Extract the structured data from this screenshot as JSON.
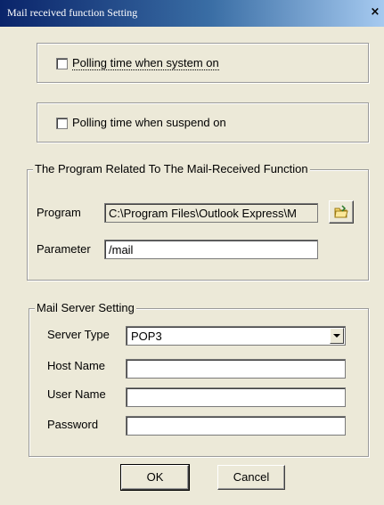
{
  "window": {
    "title": "Mail received function Setting",
    "close_glyph": "×"
  },
  "polling": {
    "system_on_label": "Polling time when system on",
    "system_on_checked": false,
    "suspend_on_label": "Polling time when suspend on",
    "suspend_on_checked": false
  },
  "program_group": {
    "legend": "The Program Related To The Mail-Received Function",
    "program_label": "Program",
    "program_value": "C:\\Program Files\\Outlook Express\\M",
    "browse_icon": "folder-browse-icon",
    "parameter_label": "Parameter",
    "parameter_value": "/mail"
  },
  "server_group": {
    "legend": "Mail Server Setting",
    "server_type_label": "Server Type",
    "server_type_value": "POP3",
    "host_name_label": "Host Name",
    "host_name_value": "",
    "user_name_label": "User Name",
    "user_name_value": "",
    "password_label": "Password",
    "password_value": ""
  },
  "buttons": {
    "ok_label": "OK",
    "cancel_label": "Cancel"
  },
  "colors": {
    "dialog_bg": "#ece9d8",
    "titlebar_start": "#0a246a",
    "titlebar_end": "#a6caf0"
  }
}
